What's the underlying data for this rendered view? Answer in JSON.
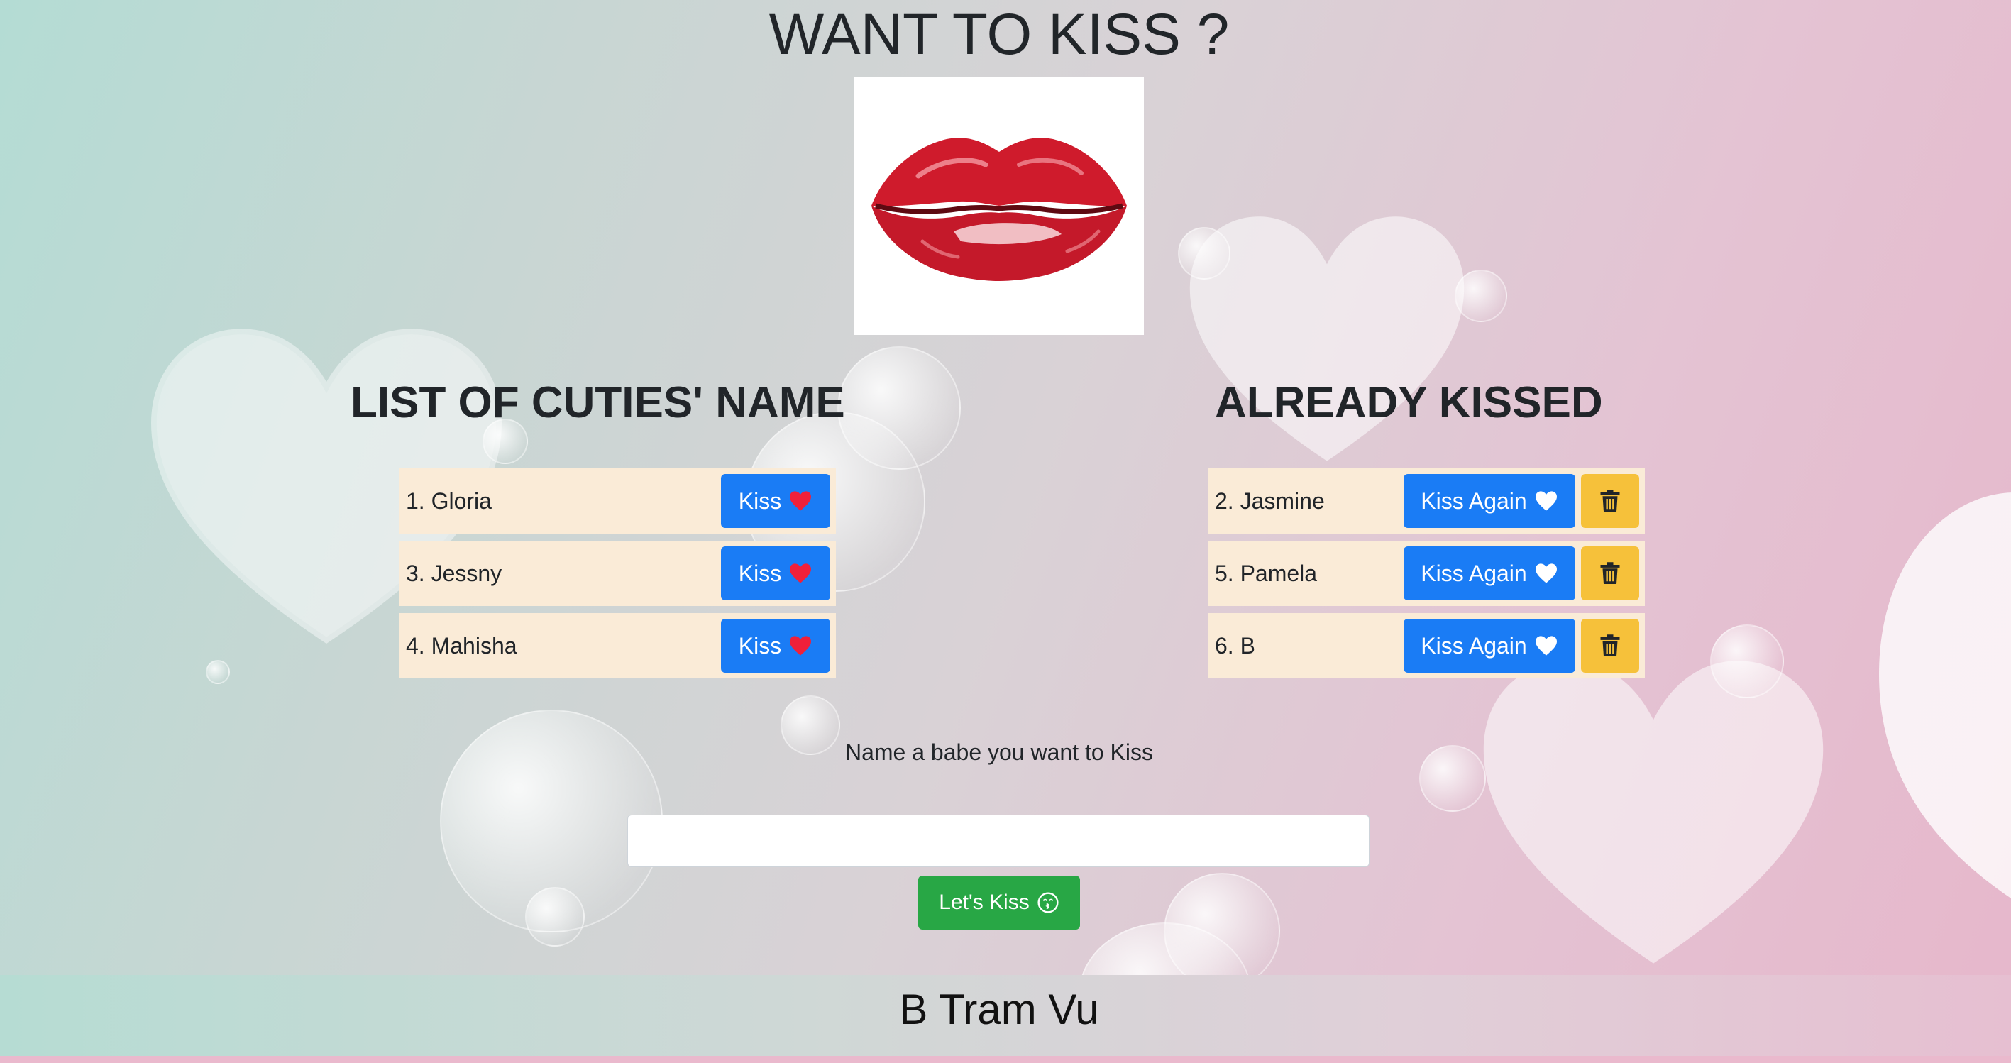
{
  "app": {
    "title": "WANT TO KISS ?"
  },
  "colors": {
    "primary_button": "#1a7cf5",
    "delete_button": "#f6c13a",
    "success_button": "#28a745",
    "row_background": "#faebd7",
    "heart_red": "#f0203a",
    "heart_white": "#ffffff"
  },
  "hero": {
    "image_name": "red-lips-image"
  },
  "to_kiss": {
    "heading": "LIST OF CUTIES' NAME",
    "button_label": "Kiss",
    "button_icon": "heart-icon",
    "items": [
      {
        "name": "1. Gloria"
      },
      {
        "name": "3. Jessny"
      },
      {
        "name": "4. Mahisha"
      }
    ]
  },
  "kissed": {
    "heading": "ALREADY KISSED",
    "button_label": "Kiss Again",
    "button_icon": "heart-icon",
    "delete_icon": "trash-icon",
    "items": [
      {
        "name": "2. Jasmine"
      },
      {
        "name": "5. Pamela"
      },
      {
        "name": "6. B"
      }
    ]
  },
  "form": {
    "label": "Name a babe you want to Kiss",
    "input_value": "",
    "input_placeholder": "",
    "submit_label": "Let's Kiss",
    "submit_icon": "kissing-face-icon"
  },
  "footer": {
    "text": "B Tram Vu"
  }
}
